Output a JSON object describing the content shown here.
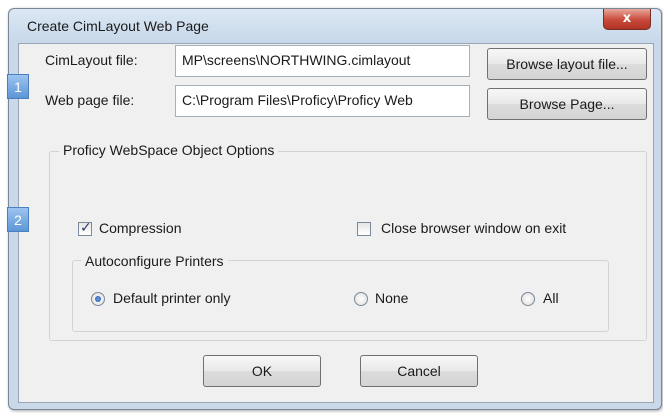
{
  "window": {
    "title": "Create CimLayout Web Page",
    "close_label": "x"
  },
  "badges": [
    "1",
    "2"
  ],
  "layout_file": {
    "label": "CimLayout file:",
    "value": "MP\\screens\\NORTHWING.cimlayout",
    "browse_label": "Browse layout file..."
  },
  "web_page_file": {
    "label": "Web page file:",
    "value": "C:\\Program Files\\Proficy\\Proficy Web",
    "browse_label": "Browse Page..."
  },
  "options": {
    "group_title": "Proficy WebSpace Object Options",
    "compression": {
      "label": "Compression",
      "checked": true
    },
    "close_browser": {
      "label": "Close browser window on exit",
      "checked": false
    }
  },
  "printers": {
    "group_title": "Autoconfigure Printers",
    "options": [
      {
        "label": "Default printer only",
        "selected": true
      },
      {
        "label": "None",
        "selected": false
      },
      {
        "label": "All",
        "selected": false
      }
    ]
  },
  "buttons": {
    "ok": "OK",
    "cancel": "Cancel"
  },
  "colors": {
    "accent": "#5d96d6",
    "close_button": "#c9493a"
  }
}
